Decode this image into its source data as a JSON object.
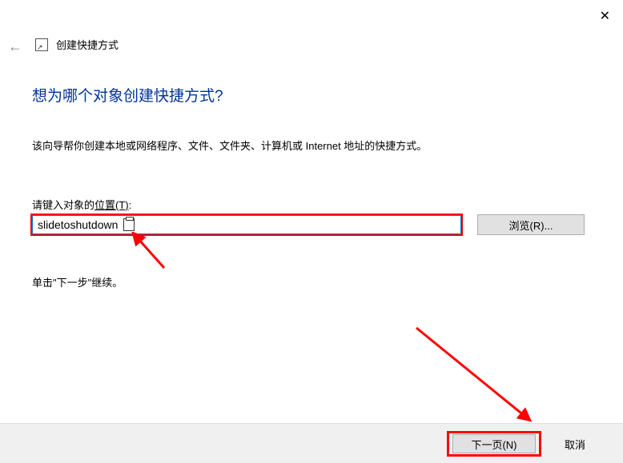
{
  "window": {
    "close": "✕"
  },
  "titlebar": {
    "title": "创建快捷方式"
  },
  "heading": "想为哪个对象创建快捷方式?",
  "description": "该向导帮你创建本地或网络程序、文件、文件夹、计算机或 Internet 地址的快捷方式。",
  "input": {
    "label_prefix": "请键入对象的",
    "label_underlined": "位置(T)",
    "label_suffix": ":",
    "value": "slidetoshutdown"
  },
  "buttons": {
    "browse": "浏览(R)...",
    "next": "下一页(N)",
    "cancel": "取消"
  },
  "continue_text": "单击\"下一步\"继续。",
  "annotations": {
    "highlight_color": "#ff0000"
  }
}
